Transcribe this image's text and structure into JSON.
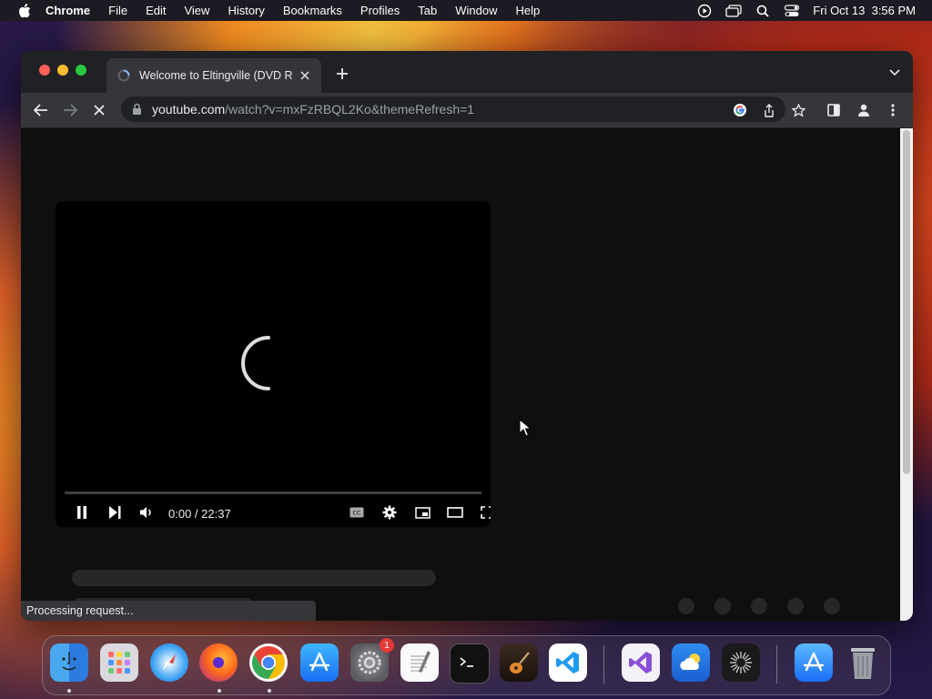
{
  "menubar": {
    "app_name": "Chrome",
    "menus": [
      "File",
      "Edit",
      "View",
      "History",
      "Bookmarks",
      "Profiles",
      "Tab",
      "Window",
      "Help"
    ],
    "clock": "Fri Oct 13  3:56 PM"
  },
  "browser": {
    "tab_title": "Welcome to Eltingville (DVD R",
    "url_host": "youtube.com",
    "url_path": "/watch?v=mxFzRBQL2Ko&themeRefresh=1",
    "status_text": "Processing request..."
  },
  "player": {
    "time_display": "0:00 / 22:37"
  },
  "dock": {
    "settings_badge": "1",
    "apps": [
      "finder",
      "launchpad",
      "safari",
      "firefox",
      "chrome",
      "app-store",
      "system-settings",
      "textedit",
      "terminal",
      "garageband",
      "vscode",
      "visual-studio",
      "weather",
      "chatgpt",
      "app-store-downloads",
      "trash"
    ]
  },
  "colors": {
    "window_bg": "#202124",
    "toolbar_bg": "#35363a",
    "page_bg": "#0f0f0f"
  }
}
